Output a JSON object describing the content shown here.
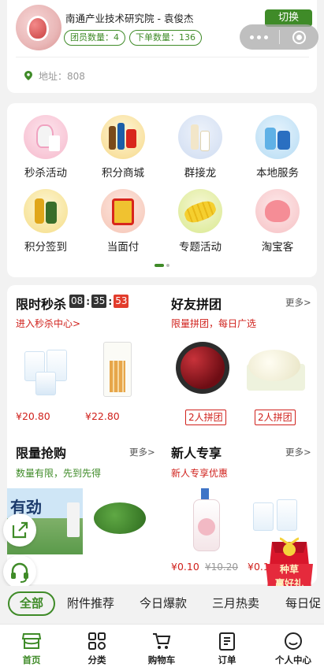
{
  "header": {
    "store_name": "南通产业技术研究院 - 袁俊杰",
    "switch_label": "切换",
    "team_count": "团员数量：4",
    "order_count": "下单数量：136",
    "address": "地址：808"
  },
  "grid": [
    {
      "label": "秒杀活动",
      "icon": "flash-sale-icon"
    },
    {
      "label": "积分商城",
      "icon": "points-mall-icon"
    },
    {
      "label": "群接龙",
      "icon": "group-relay-icon"
    },
    {
      "label": "本地服务",
      "icon": "local-service-icon"
    },
    {
      "label": "积分签到",
      "icon": "points-checkin-icon"
    },
    {
      "label": "当面付",
      "icon": "face-pay-icon"
    },
    {
      "label": "专题活动",
      "icon": "special-event-icon"
    },
    {
      "label": "淘宝客",
      "icon": "taobao-icon"
    }
  ],
  "flash_sale": {
    "title": "限时秒杀",
    "hours": "08",
    "minutes": "35",
    "seconds": "53",
    "subtitle": "进入秒杀中心>",
    "price1": "¥20.80",
    "price2": "¥22.80"
  },
  "group_buy": {
    "title": "好友拼团",
    "more": "更多>",
    "subtitle": "限量拼团，每日广选",
    "tag1": "2人拼团",
    "tag2": "2人拼团"
  },
  "limited": {
    "title": "限量抢购",
    "more": "更多>",
    "subtitle": "数量有限，先到先得",
    "banner_text": "有劲"
  },
  "newcomer": {
    "title": "新人专享",
    "more": "更多>",
    "subtitle": "新人专享优惠",
    "price": "¥0.10",
    "old_price": "¥10.20",
    "price_partial": "¥0.1"
  },
  "gift": {
    "line1": "种草",
    "line2": "赢好礼"
  },
  "categories": [
    "全部",
    "附件推荐",
    "今日爆款",
    "三月热卖",
    "每日促"
  ],
  "tabbar": [
    "首页",
    "分类",
    "购物车",
    "订单",
    "个人中心"
  ],
  "colors": {
    "brand_green": "#3f8b28",
    "price_red": "#d0211c",
    "timer_dark": "#333333",
    "timer_red": "#e23c2c"
  }
}
